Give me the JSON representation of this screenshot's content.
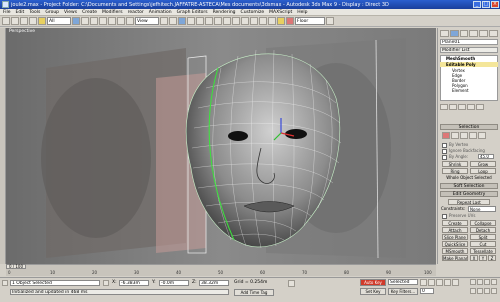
{
  "window": {
    "title": "joule2.max   -   Project Folder: C:\\Documents and Settings\\jefhitech.JAFFATRE-ASTECA\\Mes documents\\3dsmax   -   Autodesk 3ds Max 9   -   Display : Direct 3D"
  },
  "menu": [
    "File",
    "Edit",
    "Tools",
    "Group",
    "Views",
    "Create",
    "Modifiers",
    "reactor",
    "Animation",
    "Graph Editors",
    "Rendering",
    "Customize",
    "MAXScript",
    "Help"
  ],
  "toolbar": {
    "filter": "All",
    "coord": "View",
    "named_sel": "Floor"
  },
  "viewport": {
    "label": "Perspective"
  },
  "panel": {
    "object_name": "Plane01",
    "modifier_list": "Modifier List",
    "stack": [
      "MeshSmooth",
      "Editable Poly",
      "Vertex",
      "Edge",
      "Border",
      "Polygon",
      "Element"
    ],
    "selection_title": "Selection",
    "by_vertex": "By Vertex",
    "ignore_backfacing": "Ignore Backfacing",
    "by_angle": "By Angle:",
    "angle_value": "45.0",
    "shrink": "Shrink",
    "grow": "Grow",
    "ring": "Ring",
    "loop": "Loop",
    "whole_object": "Whole Object Selected",
    "soft_selection": "Soft Selection",
    "edit_geometry": "Edit Geometry",
    "repeat_last": "Repeat Last",
    "constraints": "Constraints:",
    "constraints_value": "None",
    "preserve_uvs": "Preserve UVs",
    "create": "Create",
    "collapse": "Collapse",
    "attach": "Attach",
    "detach": "Detach",
    "slice_plane": "Slice Plane",
    "split": "Split",
    "quickslice": "QuickSlice",
    "cut": "Cut",
    "msmooth": "MSmooth",
    "tessellate": "Tessellate",
    "make_planar": "Make Planar",
    "x": "X",
    "y": "Y",
    "z": "Z"
  },
  "timeline": {
    "frame_label": "0 / 100",
    "ticks": [
      "0",
      "10",
      "20",
      "30",
      "40",
      "50",
      "60",
      "70",
      "80",
      "90",
      "100"
    ]
  },
  "status": {
    "selected": "1 Object Selected",
    "prompt": "Initialized and updated in 468 ms",
    "x_label": "X:",
    "x_value": "-6.383m",
    "y_label": "Y:",
    "y_value": "-0.0m",
    "z_label": "Z:",
    "z_value": "38.32m",
    "grid": "Grid = 0.254m",
    "add_time_tag": "Add Time Tag",
    "auto_key": "Auto Key",
    "selected_dropdown": "Selected",
    "set_key": "Set Key",
    "key_filters": "Key Filters...",
    "frame_value": "0"
  }
}
